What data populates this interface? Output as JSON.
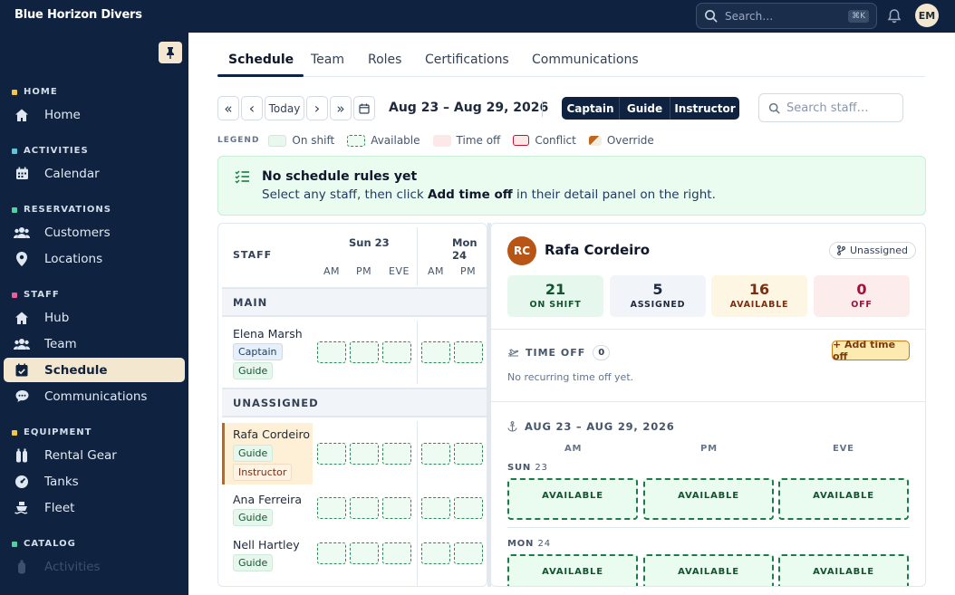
{
  "app": {
    "title": "Blue Horizon Divers"
  },
  "topbar": {
    "search_placeholder": "Search…",
    "shortcut": "⌘K",
    "avatar": "EM"
  },
  "sidebar": {
    "sections": [
      {
        "label": "HOME",
        "color": "#f5c542"
      },
      {
        "label": "ACTIVITIES",
        "color": "#5ec6d8"
      },
      {
        "label": "RESERVATIONS",
        "color": "#4fd1a1"
      },
      {
        "label": "STAFF",
        "color": "#e85d9a"
      },
      {
        "label": "EQUIPMENT",
        "color": "#f5c542"
      },
      {
        "label": "CATALOG",
        "color": "#4fd1a1"
      }
    ],
    "items": [
      {
        "label": "Home",
        "icon": "home-icon"
      },
      {
        "label": "Calendar",
        "icon": "calendar-icon"
      },
      {
        "label": "Customers",
        "icon": "users-icon"
      },
      {
        "label": "Locations",
        "icon": "map-pin-icon"
      },
      {
        "label": "Hub",
        "icon": "home-icon"
      },
      {
        "label": "Team",
        "icon": "users-icon"
      },
      {
        "label": "Schedule",
        "icon": "calendar-check-icon"
      },
      {
        "label": "Communications",
        "icon": "chat-icon"
      },
      {
        "label": "Rental Gear",
        "icon": "tanks-icon"
      },
      {
        "label": "Tanks",
        "icon": "gauge-icon"
      },
      {
        "label": "Fleet",
        "icon": "boat-icon"
      },
      {
        "label": "Activities",
        "icon": "tank-icon"
      }
    ]
  },
  "tabs": [
    "Schedule",
    "Team",
    "Roles",
    "Certifications",
    "Communications"
  ],
  "toolbar": {
    "first": "«",
    "prev": "‹",
    "today": "Today",
    "next": "›",
    "last": "»",
    "range": "Aug 23 – Aug 29, 2026",
    "roles": [
      "Captain",
      "Guide",
      "Instructor"
    ],
    "search_placeholder": "Search staff…"
  },
  "legend": {
    "title": "LEGEND",
    "items": [
      {
        "label": "On shift",
        "color": "#e8f8ee"
      },
      {
        "label": "Available",
        "color": "#eefbf3"
      },
      {
        "label": "Time off",
        "color": "#fde8e8"
      },
      {
        "label": "Conflict",
        "color": "#c4122f"
      },
      {
        "label": "Override",
        "color": "#c2651a"
      }
    ]
  },
  "banner": {
    "title": "No schedule rules yet",
    "text_before": "Select any staff, then click ",
    "text_bold": "Add time off",
    "text_after": " in their detail panel on the right."
  },
  "grid": {
    "staff_header": "STAFF",
    "days": [
      {
        "label": "Sun 23"
      },
      {
        "label": "Mon 24"
      }
    ],
    "slots": [
      "AM",
      "PM",
      "EVE"
    ],
    "groups": [
      {
        "label": "MAIN",
        "staff": [
          {
            "name": "Elena Marsh",
            "roles": [
              "Captain",
              "Guide"
            ]
          }
        ]
      },
      {
        "label": "UNASSIGNED",
        "staff": [
          {
            "name": "Rafa Cordeiro",
            "roles": [
              "Guide",
              "Instructor"
            ]
          },
          {
            "name": "Ana Ferreira",
            "roles": [
              "Guide"
            ]
          },
          {
            "name": "Nell Hartley",
            "roles": [
              "Guide"
            ]
          }
        ]
      }
    ]
  },
  "panel": {
    "initials": "RC",
    "name": "Rafa Cordeiro",
    "group": "Unassigned",
    "stats": [
      {
        "value": "21",
        "label": "ON SHIFT",
        "bg": "#e6f8ee",
        "fg": "#14532d"
      },
      {
        "value": "5",
        "label": "ASSIGNED",
        "bg": "#f1f5f9",
        "fg": "#1e293b"
      },
      {
        "value": "16",
        "label": "AVAILABLE",
        "bg": "#fdf6e3",
        "fg": "#7c2d12"
      },
      {
        "value": "0",
        "label": "OFF",
        "bg": "#fdecec",
        "fg": "#9f1239"
      }
    ],
    "time_off": {
      "title": "TIME OFF",
      "count": "0",
      "add_label": "+ Add time off",
      "empty": "No recurring time off yet."
    },
    "week": {
      "range": "AUG 23 – AUG 29, 2026",
      "slots": [
        "AM",
        "PM",
        "EVE"
      ],
      "days": [
        {
          "dow": "SUN",
          "date": "23",
          "cells": [
            "AVAILABLE",
            "AVAILABLE",
            "AVAILABLE"
          ]
        },
        {
          "dow": "MON",
          "date": "24",
          "cells": [
            "AVAILABLE",
            "AVAILABLE",
            "AVAILABLE"
          ]
        }
      ]
    }
  }
}
